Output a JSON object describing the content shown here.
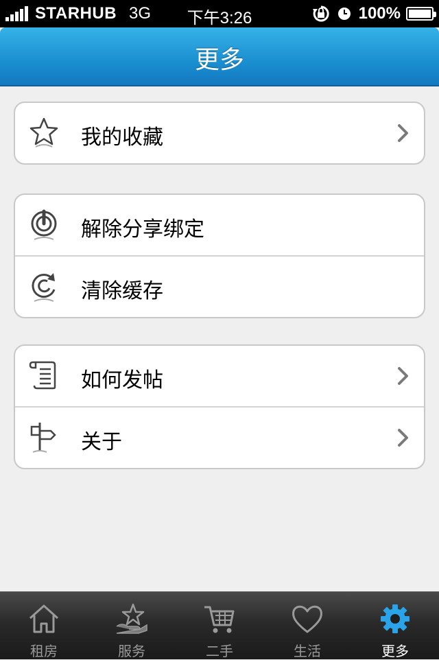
{
  "status_bar": {
    "carrier": "STARHUB",
    "network": "3G",
    "time": "下午3:26",
    "battery": "100%",
    "battery_level": 1.0
  },
  "nav": {
    "title": "更多"
  },
  "groups": [
    {
      "items": [
        {
          "label": "我的收藏",
          "icon": "star-icon",
          "chevron": true
        }
      ]
    },
    {
      "items": [
        {
          "label": "解除分享绑定",
          "icon": "power-icon",
          "chevron": false
        },
        {
          "label": "清除缓存",
          "icon": "clear-cache-icon",
          "chevron": false
        }
      ]
    },
    {
      "items": [
        {
          "label": "如何发帖",
          "icon": "scroll-icon",
          "chevron": true
        },
        {
          "label": "关于",
          "icon": "signpost-icon",
          "chevron": true
        }
      ]
    }
  ],
  "tabbar": {
    "tabs": [
      {
        "label": "租房",
        "icon": "house-icon",
        "active": false
      },
      {
        "label": "服务",
        "icon": "service-star-icon",
        "active": false
      },
      {
        "label": "二手",
        "icon": "cart-icon",
        "active": false
      },
      {
        "label": "生活",
        "icon": "heart-icon",
        "active": false
      },
      {
        "label": "更多",
        "icon": "gear-icon",
        "active": true
      }
    ]
  },
  "colors": {
    "nav_blue": "#1a8fd0",
    "active_tab": "#2aa3e8",
    "tab_inactive": "#9a9a9a"
  }
}
